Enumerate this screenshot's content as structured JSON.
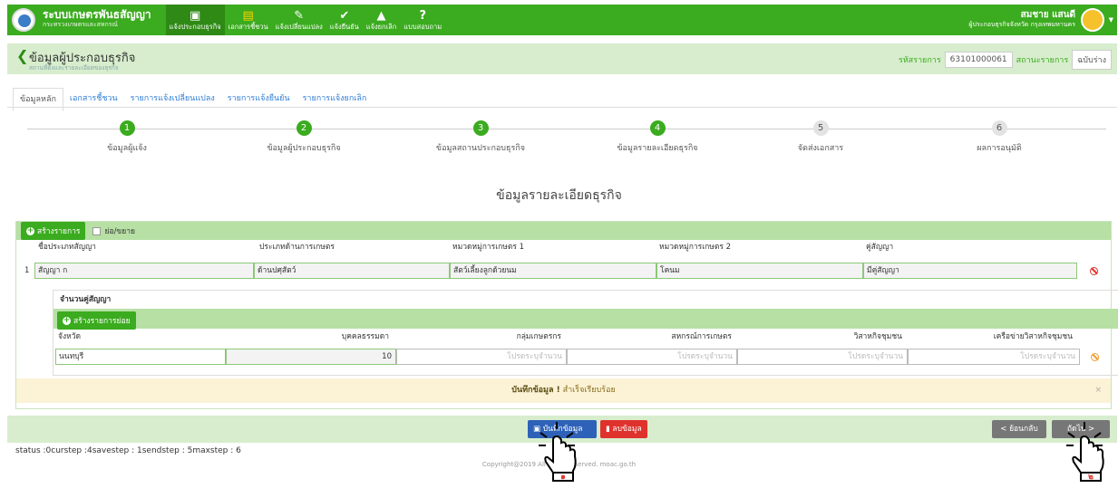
{
  "app": {
    "title": "ระบบเกษตรพันธสัญญา",
    "subtitle": "กระทรวงเกษตรและสหกรณ์"
  },
  "menu": [
    {
      "icon": "id-card-icon",
      "glyph": "▣",
      "label": "แจ้งประกอบธุรกิจ",
      "active": true
    },
    {
      "icon": "document-icon",
      "glyph": "▤",
      "label": "เอกสารชี้ชวน"
    },
    {
      "icon": "edit-icon",
      "glyph": "✎",
      "label": "แจ้งเปลี่ยนแปลง"
    },
    {
      "icon": "check-icon",
      "glyph": "✔",
      "label": "แจ้งยืนยัน"
    },
    {
      "icon": "warning-icon",
      "glyph": "▲",
      "label": "แจ้งยกเลิก"
    },
    {
      "icon": "question-icon",
      "glyph": "?",
      "label": "แบบสอบถาม"
    }
  ],
  "user": {
    "name": "สมชาย แสนดี",
    "role": "ผู้ประกอบธุรกิจจังหวัด กรุงเทพมหานคร"
  },
  "page": {
    "title": "ข้อมูลผู้ประกอบธุรกิจ",
    "subtitle": "สถานที่ตั้งและรายละเอียดของธุรกิจ",
    "doc_code_label": "รหัสรายการ",
    "doc_code": "63101000061",
    "doc_status_label": "สถานะรายการ",
    "doc_status": "ฉบับร่าง"
  },
  "tabs": [
    "ข้อมูลหลัก",
    "เอกสารชี้ชวน",
    "รายการแจ้งเปลี่ยนแปลง",
    "รายการแจ้งยืนยัน",
    "รายการแจ้งยกเลิก"
  ],
  "steps": [
    {
      "num": "1",
      "label": "ข้อมูลผู้แจ้ง",
      "done": true
    },
    {
      "num": "2",
      "label": "ข้อมูลผู้ประกอบธุรกิจ",
      "done": true
    },
    {
      "num": "3",
      "label": "ข้อมูลสถานประกอบธุรกิจ",
      "done": true
    },
    {
      "num": "4",
      "label": "ข้อมูลรายละเอียดธุรกิจ",
      "done": true
    },
    {
      "num": "5",
      "label": "จัดส่งเอกสาร",
      "done": false
    },
    {
      "num": "6",
      "label": "ผลการอนุมัติ",
      "done": false
    }
  ],
  "section_heading": "ข้อมูลรายละเอียดธุรกิจ",
  "grid": {
    "add_label": "สร้างรายการ",
    "collapse_label": "ย่อ/ขยาย",
    "headers": [
      "ชื่อประเภทสัญญา",
      "ประเภทด้านการเกษตร",
      "หมวดหมู่การเกษตร 1",
      "หมวดหมู่การเกษตร 2",
      "คู่สัญญา"
    ],
    "row": {
      "index": "1",
      "values": [
        "สัญญา ก",
        "ด้านปศุสัตว์",
        "สัตว์เลี้ยงลูกด้วยนม",
        "โคนม",
        "มีคู่สัญญา"
      ]
    }
  },
  "subgrid": {
    "title": "จำนวนคู่สัญญา",
    "add_label": "สร้างรายการย่อย",
    "headers": [
      "จังหวัด",
      "บุคคลธรรมดา",
      "กลุ่มเกษตรกร",
      "สหกรณ์การเกษตร",
      "วิสาหกิจชุมชน",
      "เครือข่ายวิสาหกิจชุมชน"
    ],
    "province": "นนทบุรี",
    "individual": "10",
    "placeholder": "โปรดระบุจำนวน"
  },
  "alert": {
    "bold": "บันทึกข้อมูล !",
    "text": "สำเร็จเรียบร้อย",
    "close": "×"
  },
  "buttons": {
    "save": "บันทึกข้อมูล",
    "delete": "ลบข้อมูล",
    "back": "< ย้อนกลับ",
    "next": "ถัดไป >"
  },
  "status_text": "status :0curstep :4savestep : 1sendstep : 5maxstep : 6",
  "copyright": "Copyright@2019 All rights reserved. moac.go.th",
  "markers": [
    "๑",
    "๒"
  ]
}
